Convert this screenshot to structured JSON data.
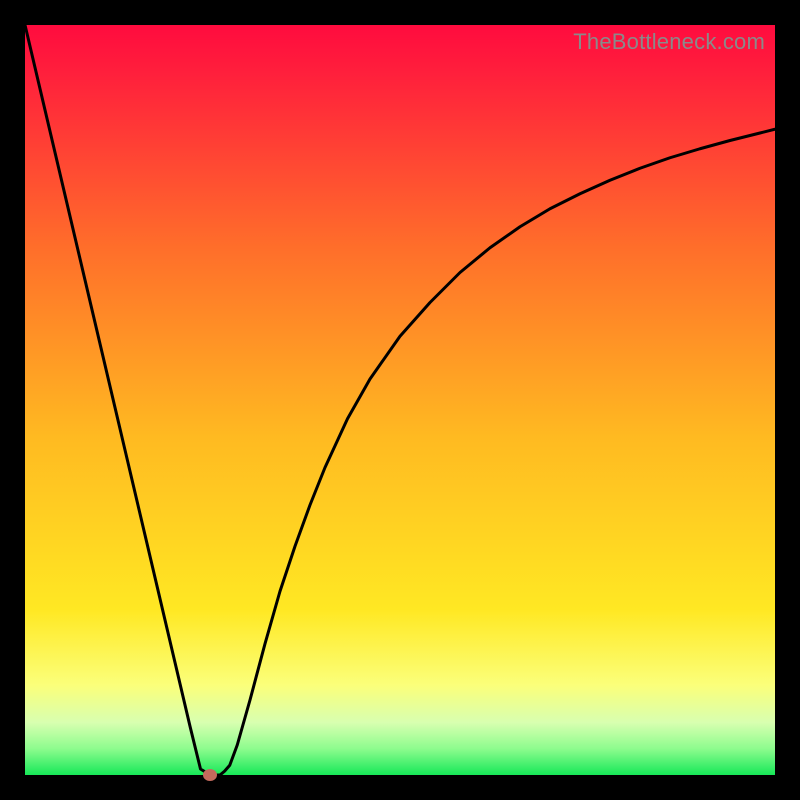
{
  "attribution": "TheBottleneck.com",
  "chart_data": {
    "type": "line",
    "title": "",
    "xlabel": "",
    "ylabel": "",
    "xlim": [
      0,
      100
    ],
    "ylim": [
      0,
      100
    ],
    "grid": false,
    "legend": false,
    "background_gradient": {
      "description": "vertical gradient red→orange→yellow→pale-yellow→green, bottom = good",
      "stops": [
        {
          "pos": 0.0,
          "color": "#ff0b3e"
        },
        {
          "pos": 0.06,
          "color": "#ff1e3c"
        },
        {
          "pos": 0.3,
          "color": "#ff6f2a"
        },
        {
          "pos": 0.55,
          "color": "#ffba21"
        },
        {
          "pos": 0.78,
          "color": "#ffe823"
        },
        {
          "pos": 0.88,
          "color": "#fbff7a"
        },
        {
          "pos": 0.93,
          "color": "#d8ffb0"
        },
        {
          "pos": 0.965,
          "color": "#8dfc8e"
        },
        {
          "pos": 1.0,
          "color": "#17e858"
        }
      ]
    },
    "series": [
      {
        "name": "bottleneck-curve",
        "color": "#000000",
        "x": [
          0.0,
          2.0,
          4.0,
          6.0,
          8.0,
          10.0,
          12.0,
          14.0,
          16.0,
          18.0,
          20.0,
          22.0,
          23.4,
          24.7,
          25.3,
          26.0,
          26.6,
          27.3,
          28.3,
          30.0,
          32.0,
          34.0,
          36.0,
          38.0,
          40.0,
          43.0,
          46.0,
          50.0,
          54.0,
          58.0,
          62.0,
          66.0,
          70.0,
          74.0,
          78.0,
          82.0,
          86.0,
          90.0,
          94.0,
          98.0,
          100.0
        ],
        "y": [
          100.0,
          91.5,
          83.0,
          74.5,
          66.0,
          57.5,
          49.0,
          40.5,
          32.0,
          23.5,
          15.0,
          6.5,
          0.8,
          0.0,
          0.0,
          0.0,
          0.5,
          1.3,
          4.0,
          10.0,
          17.5,
          24.5,
          30.5,
          36.0,
          41.0,
          47.5,
          52.8,
          58.5,
          63.0,
          67.0,
          70.3,
          73.1,
          75.5,
          77.5,
          79.3,
          80.9,
          82.3,
          83.5,
          84.6,
          85.6,
          86.1
        ]
      }
    ],
    "marker": {
      "name": "optimal-point",
      "x": 24.7,
      "y": 0.0,
      "color": "#c36a5d"
    }
  }
}
